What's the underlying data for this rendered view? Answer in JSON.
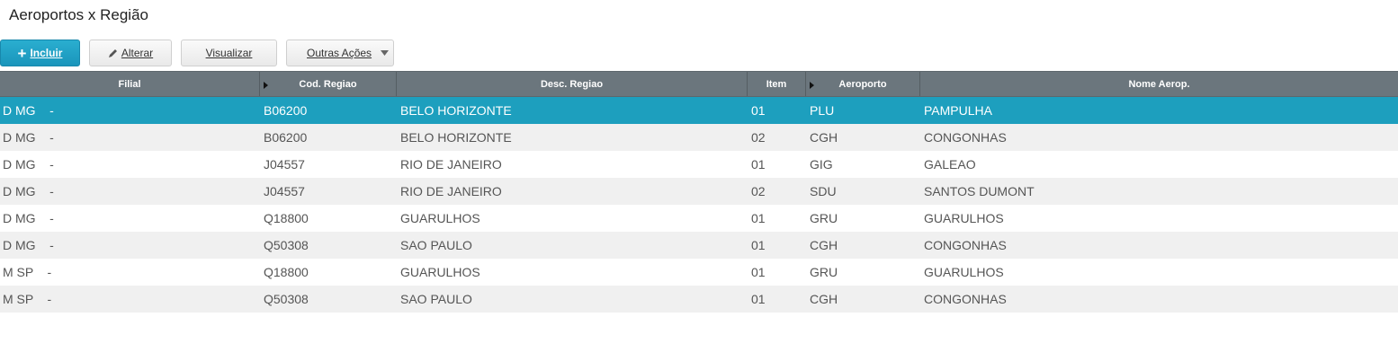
{
  "page": {
    "title": "Aeroportos x Região"
  },
  "toolbar": {
    "incluir": "Incluir",
    "alterar": "Alterar",
    "visualizar": "Visualizar",
    "outras_acoes": "Outras Ações"
  },
  "table": {
    "columns": [
      "Filial",
      "Cod. Regiao",
      "Desc. Regiao",
      "Item",
      "Aeroporto",
      "Nome Aerop."
    ],
    "rows": [
      [
        "D MG    -",
        "B06200",
        "BELO HORIZONTE",
        "01",
        "PLU",
        "PAMPULHA"
      ],
      [
        "D MG    -",
        "B06200",
        "BELO HORIZONTE",
        "02",
        "CGH",
        "CONGONHAS"
      ],
      [
        "D MG    -",
        "J04557",
        "RIO DE JANEIRO",
        "01",
        "GIG",
        "GALEAO"
      ],
      [
        "D MG    -",
        "J04557",
        "RIO DE JANEIRO",
        "02",
        "SDU",
        "SANTOS DUMONT"
      ],
      [
        "D MG    -",
        "Q18800",
        "GUARULHOS",
        "01",
        "GRU",
        "GUARULHOS"
      ],
      [
        "D MG    -",
        "Q50308",
        "SAO PAULO",
        "01",
        "CGH",
        "CONGONHAS"
      ],
      [
        "M SP    -",
        "Q18800",
        "GUARULHOS",
        "01",
        "GRU",
        "GUARULHOS"
      ],
      [
        "M SP    -",
        "Q50308",
        "SAO PAULO",
        "01",
        "CGH",
        "CONGONHAS"
      ]
    ],
    "selected_row": 0
  },
  "colors": {
    "header_bg": "#6b767d",
    "selected_row": "#1d9fbe",
    "primary_button": "#1a95bb",
    "alt_row": "#f0f0f0"
  },
  "icons": {
    "incluir": "plus-icon",
    "alterar": "pencil-icon",
    "outras_acoes": "caret-down-icon",
    "sort": "sort-arrow-icon"
  }
}
